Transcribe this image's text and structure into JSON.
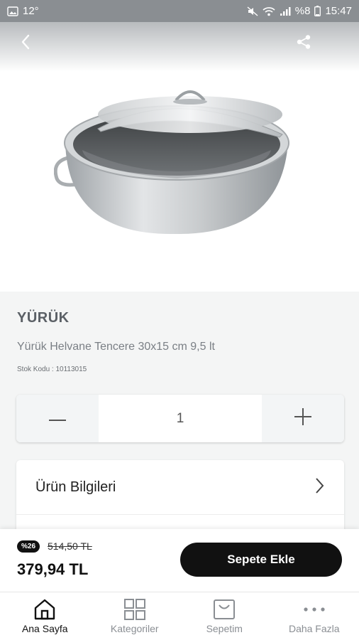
{
  "status_bar": {
    "temperature": "12°",
    "battery": "%8",
    "time": "15:47"
  },
  "product": {
    "brand": "YÜRÜK",
    "name": "Yürük Helvane Tencere 30x15 cm 9,5 lt",
    "stock_code": "Stok Kodu : 10113015"
  },
  "quantity": {
    "value": "1",
    "decrement_icon": "minus-icon",
    "increment_icon": "plus-icon"
  },
  "info": {
    "label": "Ürün Bilgileri"
  },
  "pricing": {
    "discount": "%26",
    "old_price": "514,50 TL",
    "new_price": "379,94 TL",
    "cart_label": "Sepete Ekle"
  },
  "tabs": [
    {
      "label": "Ana Sayfa",
      "icon": "home-icon",
      "active": true
    },
    {
      "label": "Kategoriler",
      "icon": "grid-icon",
      "active": false
    },
    {
      "label": "Sepetim",
      "icon": "bag-icon",
      "active": false
    },
    {
      "label": "Daha Fazla",
      "icon": "more-icon",
      "active": false
    }
  ],
  "colors": {
    "primary": "#111111",
    "muted_text": "#8a8e93",
    "background": "#f4f5f5"
  }
}
